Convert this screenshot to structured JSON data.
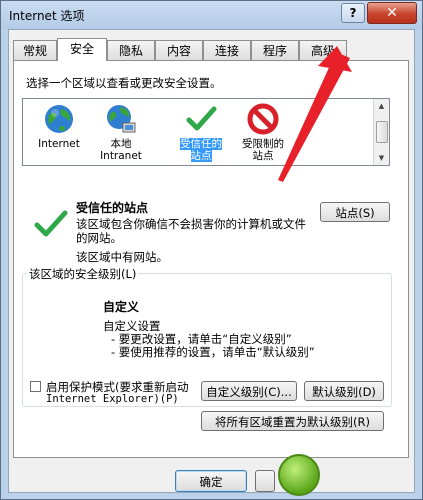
{
  "window": {
    "title": "Internet 选项",
    "help_glyph": "?",
    "close_glyph": "✕"
  },
  "tabs": [
    "常规",
    "安全",
    "隐私",
    "内容",
    "连接",
    "程序",
    "高级"
  ],
  "active_tab": "安全",
  "instruction": "选择一个区域以查看或更改安全设置。",
  "zones": [
    {
      "label": "Internet",
      "icon": "globe-icon"
    },
    {
      "label": "本地\nIntranet",
      "icon": "intranet-globe-icon"
    },
    {
      "label": "受信任的\n站点",
      "icon": "green-checkmark-icon",
      "selected": true
    },
    {
      "label": "受限制的\n站点",
      "icon": "restricted-circle-icon"
    }
  ],
  "zone_detail": {
    "title": "受信任的站点",
    "description": "该区域包含你确信不会损害你的计算机或文件的网站。",
    "count_text": "该区域中有网站。",
    "sites_button": "站点(S)"
  },
  "security_level": {
    "group_label": "该区域的安全级别(L)",
    "level_name": "自定义",
    "line1": "自定义设置",
    "line2": "- 要更改设置，请单击“自定义级别”",
    "line3": "- 要使用推荐的设置，请单击“默认级别”"
  },
  "protected_mode": {
    "label_line1": "启用保护模式(要求重新启动",
    "label_line2": "Internet Explorer)(P)",
    "checked": false
  },
  "buttons": {
    "custom_level": "自定义级别(C)...",
    "default_level": "默认级别(D)",
    "reset_all": "将所有区域重置为默认级别(R)",
    "ok": "确定"
  },
  "colors": {
    "selection": "#3399ff",
    "arrow": "#e8202a",
    "title_bg": "#bcd2ea"
  }
}
